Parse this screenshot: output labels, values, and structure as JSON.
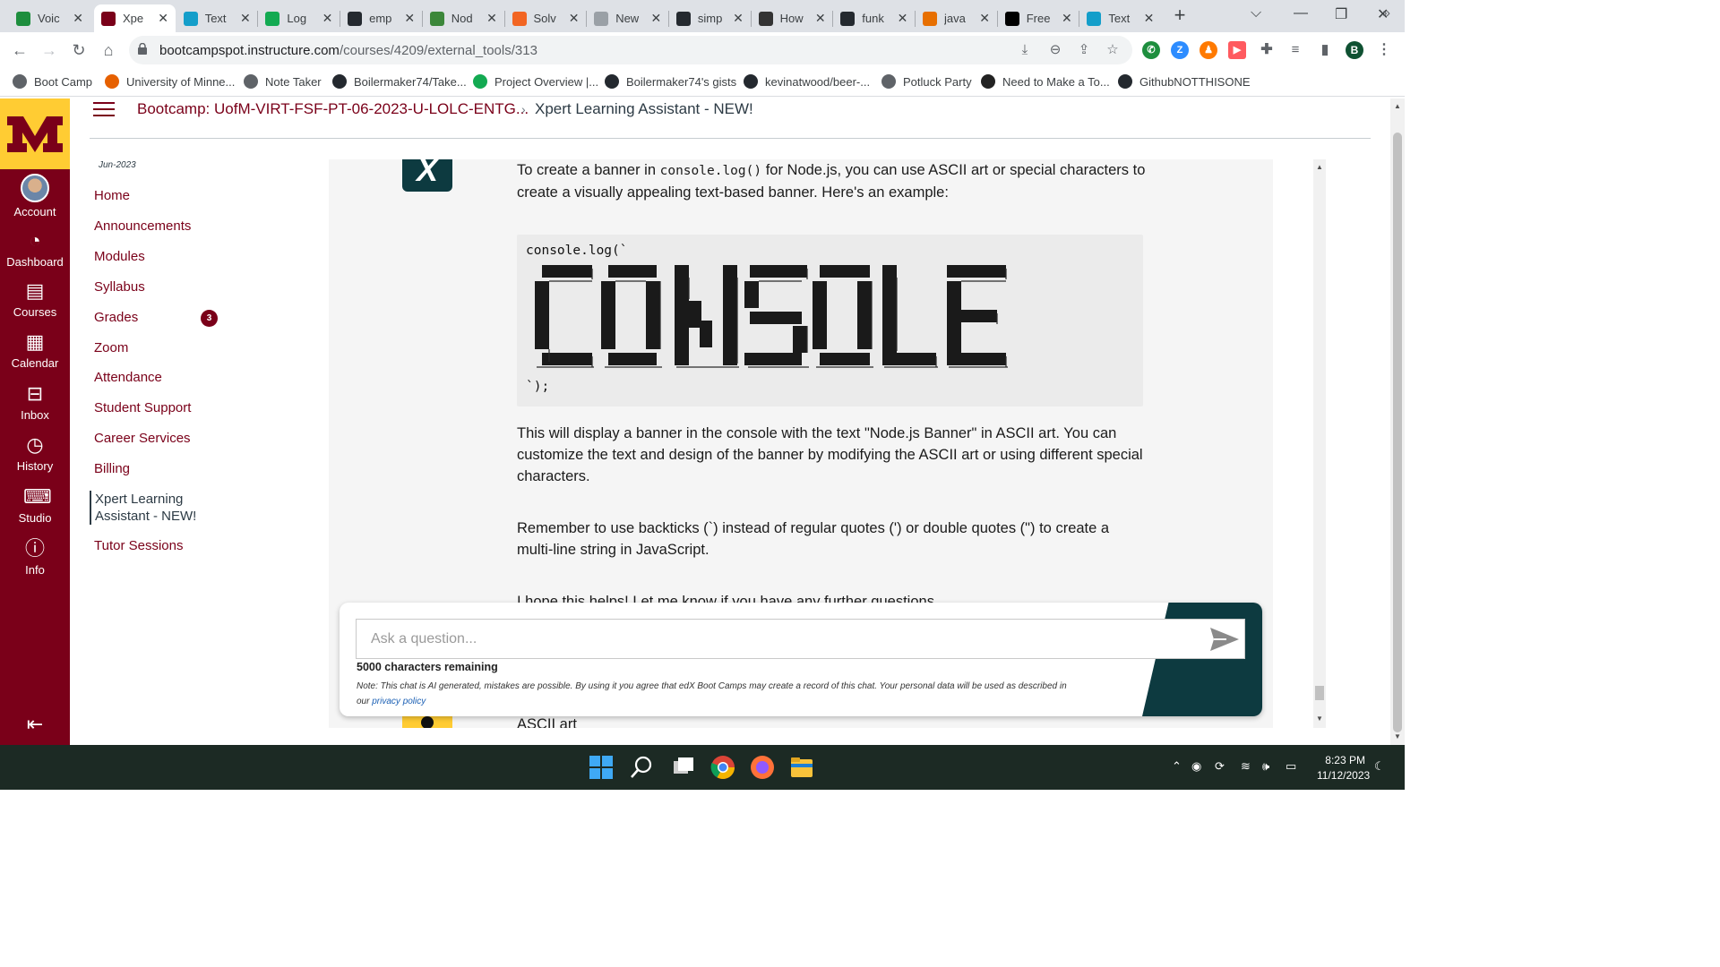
{
  "browser": {
    "tabs": [
      {
        "label": "Voic",
        "icon": "google-voice-icon",
        "color": "#1e8e3e"
      },
      {
        "label": "Xpe",
        "icon": "umn-icon",
        "color": "#7a0019",
        "active": true
      },
      {
        "label": "Text",
        "icon": "react-icon",
        "color": "#149eca"
      },
      {
        "label": "Log",
        "icon": "mongodb-icon",
        "color": "#13aa52"
      },
      {
        "label": "emp",
        "icon": "github-icon",
        "color": "#24292f"
      },
      {
        "label": "Nod",
        "icon": "node-icon",
        "color": "#3c873a"
      },
      {
        "label": "Solv",
        "icon": "codesolver-icon",
        "color": "#f26522"
      },
      {
        "label": "New",
        "icon": "globe-icon",
        "color": "#9aa0a6"
      },
      {
        "label": "simp",
        "icon": "github-icon",
        "color": "#24292f"
      },
      {
        "label": "How",
        "icon": "w-icon",
        "color": "#333333"
      },
      {
        "label": "funk",
        "icon": "github-icon",
        "color": "#24292f"
      },
      {
        "label": "java",
        "icon": "java-icon",
        "color": "#e76f00"
      },
      {
        "label": "Free",
        "icon": "ff-icon",
        "color": "#000000"
      },
      {
        "label": "Text",
        "icon": "react-icon",
        "color": "#149eca"
      }
    ],
    "url_host": "bootcampspot.instructure.com",
    "url_path": "/courses/4209/external_tools/313",
    "profile_initial": "B",
    "bookmarks": [
      {
        "label": "Boot Camp",
        "icon": "globe-icon",
        "color": "#5f6368"
      },
      {
        "label": "University of Minne...",
        "icon": "fox-icon",
        "color": "#e66000"
      },
      {
        "label": "Note Taker",
        "icon": "globe-icon",
        "color": "#5f6368"
      },
      {
        "label": "Boilermaker74/Take...",
        "icon": "github-icon",
        "color": "#24292f"
      },
      {
        "label": "Project Overview |...",
        "icon": "mongodb-icon",
        "color": "#13aa52"
      },
      {
        "label": "Boilermaker74's gists",
        "icon": "github-icon",
        "color": "#24292f"
      },
      {
        "label": "kevinatwood/beer-...",
        "icon": "github-icon",
        "color": "#24292f"
      },
      {
        "label": "Potluck Party",
        "icon": "globe-icon",
        "color": "#5f6368"
      },
      {
        "label": "Need to Make a To...",
        "icon": "openai-icon",
        "color": "#222222"
      },
      {
        "label": "GithubNOTTHISONE",
        "icon": "github-icon",
        "color": "#24292f"
      }
    ]
  },
  "global_nav": {
    "items": [
      {
        "label": "Account",
        "icon": "avatar-icon"
      },
      {
        "label": "Dashboard",
        "icon": "dashboard-icon"
      },
      {
        "label": "Courses",
        "icon": "courses-icon"
      },
      {
        "label": "Calendar",
        "icon": "calendar-icon"
      },
      {
        "label": "Inbox",
        "icon": "inbox-icon"
      },
      {
        "label": "History",
        "icon": "history-icon"
      },
      {
        "label": "Studio",
        "icon": "studio-icon"
      },
      {
        "label": "Info",
        "icon": "info-icon"
      }
    ],
    "brand_color": "#7a0019",
    "logo_color": "#ffcc33"
  },
  "header": {
    "breadcrumb_course": "Bootcamp: UofM-VIRT-FSF-PT-06-2023-U-LOLC-ENTG...",
    "breadcrumb_page": "Xpert Learning Assistant - NEW!"
  },
  "course_nav": {
    "term": "Jun-2023",
    "items": [
      {
        "label": "Home"
      },
      {
        "label": "Announcements"
      },
      {
        "label": "Modules"
      },
      {
        "label": "Syllabus"
      },
      {
        "label": "Grades",
        "badge": "3"
      },
      {
        "label": "Zoom"
      },
      {
        "label": "Attendance"
      },
      {
        "label": "Student Support"
      },
      {
        "label": "Career Services"
      },
      {
        "label": "Billing"
      },
      {
        "label": "Xpert Learning Assistant - NEW!",
        "active": true
      },
      {
        "label": "Tutor Sessions"
      }
    ]
  },
  "chat": {
    "bot_logo": "X",
    "intro_pre": "To create a banner in ",
    "intro_code": "console.log()",
    "intro_post": " for Node.js, you can use ASCII art or special characters to create a visually appealing text-based banner. Here's an example:",
    "code_open": "console.log(`",
    "code_close": "`);",
    "explain": "This will display a banner in the console with the text \"Node.js Banner\" in ASCII art. You can customize the text and design of the banner by modifying the ASCII art or using different special characters.",
    "remember": "Remember to use backticks (`) instead of regular quotes (') or double quotes (\") to create a multi-line string in JavaScript.",
    "hope": "I hope this helps! Let me know if you have any further questions.",
    "next_user_msg": "ASCII art"
  },
  "ask": {
    "placeholder": "Ask a question...",
    "chars_remaining": "5000 characters remaining",
    "note": "Note: This chat is AI generated, mistakes are possible. By using it you agree that edX Boot Camps may create a record of this chat. Your personal data will be used as described in our",
    "privacy_link": "privacy policy",
    "accent_color": "#0d3a40"
  },
  "taskbar": {
    "time": "8:23 PM",
    "date": "11/12/2023"
  }
}
